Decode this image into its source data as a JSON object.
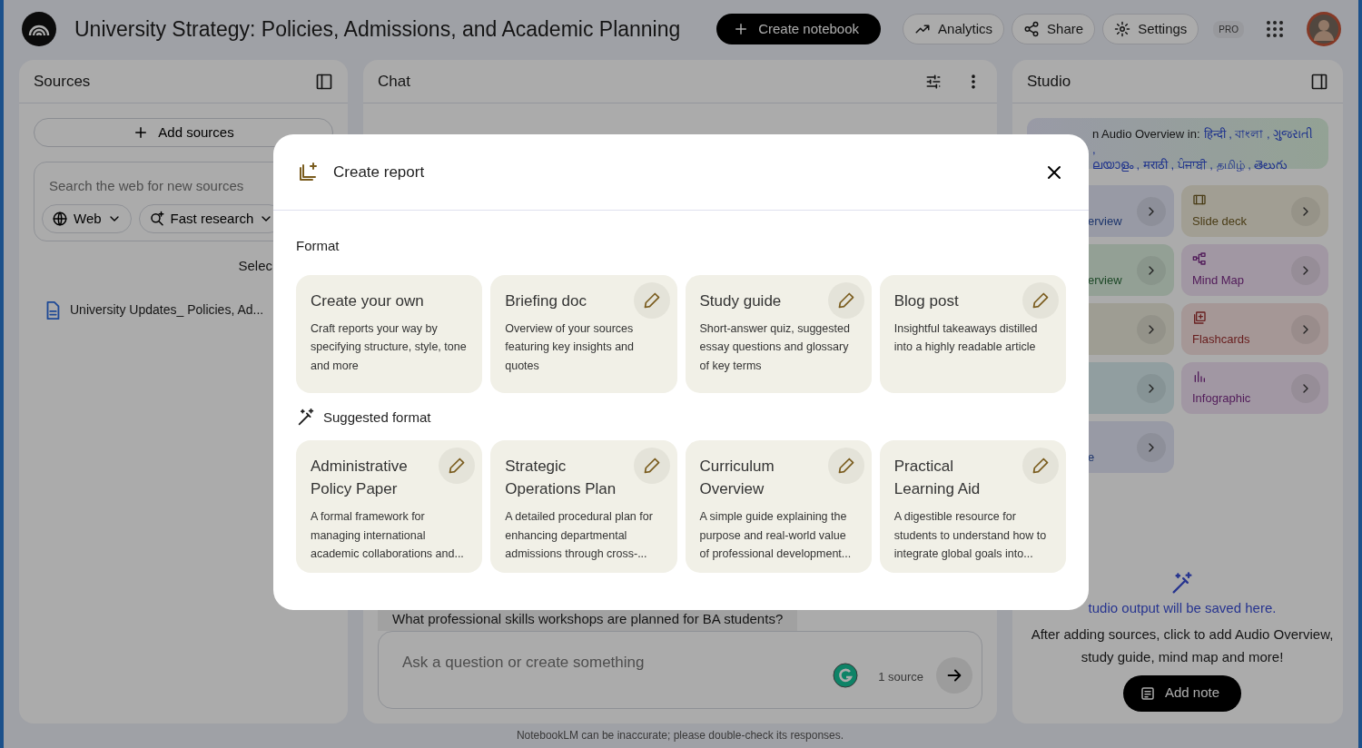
{
  "app": {
    "title": "University Strategy: Policies, Admissions, and Academic Planning",
    "create_button": "Create notebook",
    "actions": [
      {
        "kind": "analytics",
        "label": "Analytics"
      },
      {
        "kind": "share",
        "label": "Share"
      },
      {
        "kind": "settings",
        "label": "Settings"
      }
    ],
    "plan_badge": "PRO"
  },
  "sources_panel": {
    "title": "Sources",
    "add_button": "Add sources",
    "search_placeholder": "Search the web for new sources",
    "chips": [
      {
        "kind": "web",
        "label": "Web"
      },
      {
        "kind": "research",
        "label": "Fast research"
      }
    ],
    "select_fragment": "Selec",
    "sources": [
      {
        "name": "University Updates_ Policies, Ad..."
      }
    ]
  },
  "chat_panel": {
    "title": "Chat",
    "suggestion": "What professional skills workshops are planned for BA students?",
    "input_placeholder": "Ask a question or create something",
    "source_count": "1 source",
    "disclaimer": "NotebookLM can be inaccurate; please double-check its responses."
  },
  "studio_panel": {
    "title": "Studio",
    "banner_prefix": "n Audio Overview in:",
    "separator": ",",
    "language_lines": [
      [
        "हिन्दी",
        "বাংলা",
        "ગુજરાતી"
      ],
      [
        "ലയാളം",
        "मराठी",
        "ਪੰਜਾਬੀ",
        "தமிழ்",
        "తెలుగు"
      ]
    ],
    "tiles": [
      {
        "kind": "covered",
        "label": "erview"
      },
      {
        "kind": "slides",
        "label": "Slide deck"
      },
      {
        "kind": "covered",
        "label": "erview"
      },
      {
        "kind": "mindmap",
        "label": "Mind Map"
      },
      {
        "kind": "covered"
      },
      {
        "kind": "flashcards",
        "label": "Flashcards"
      },
      {
        "kind": "covered"
      },
      {
        "kind": "infographic",
        "label": "Infographic"
      },
      {
        "kind": "covered",
        "label": "e"
      }
    ],
    "empty_title": "tudio output will be saved here.",
    "empty_text": "After adding sources, click to add Audio Overview, study guide, mind map and more!",
    "add_note": "Add note"
  },
  "modal": {
    "title": "Create report",
    "format_label": "Format",
    "formats": [
      {
        "title": "Create your own",
        "description": "Craft reports your way by specifying structure, style, tone and more",
        "editable": false
      },
      {
        "title": "Briefing doc",
        "description": "Overview of your sources featuring key insights and quotes",
        "editable": true
      },
      {
        "title": "Study guide",
        "description": "Short-answer quiz, suggested essay questions and glossary of key terms",
        "editable": true
      },
      {
        "title": "Blog post",
        "description": "Insightful takeaways distilled into a highly readable article",
        "editable": true
      }
    ],
    "suggested_label": "Suggested format",
    "suggested": [
      {
        "title": "Administrative Policy Paper",
        "description": "A formal framework for managing international academic collaborations and...",
        "editable": true
      },
      {
        "title": "Strategic Operations Plan",
        "description": "A detailed procedural plan for enhancing departmental admissions through cross-...",
        "editable": true
      },
      {
        "title": "Curriculum Overview",
        "description": "A simple guide explaining the purpose and real-world value of professional development...",
        "editable": true
      },
      {
        "title": "Practical Learning Aid",
        "description": "A digestible resource for students to understand how to integrate global goals into...",
        "editable": true
      }
    ]
  }
}
